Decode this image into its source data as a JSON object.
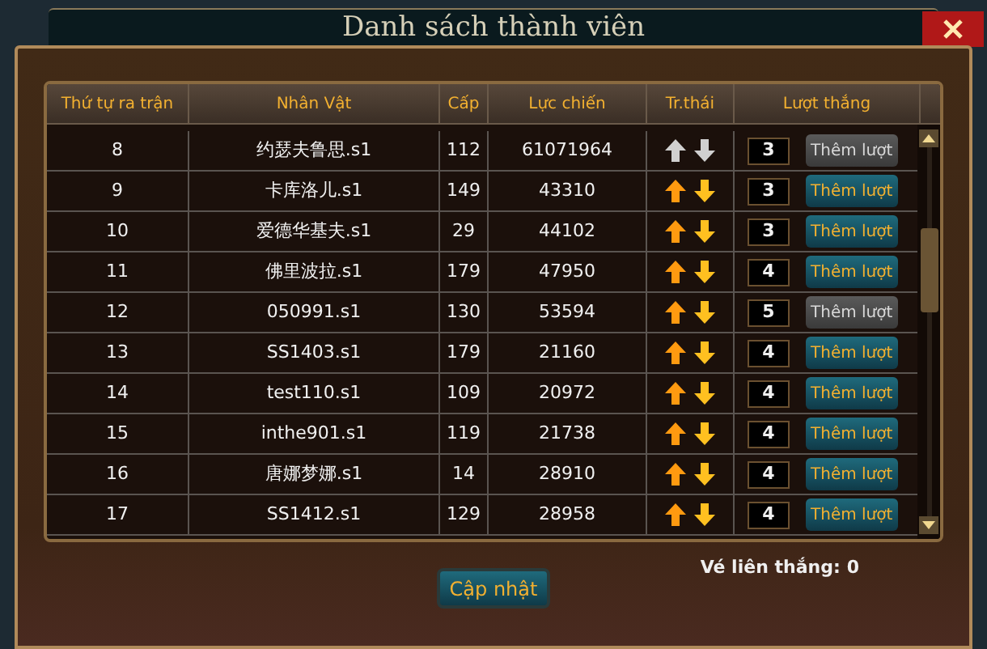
{
  "window": {
    "title": "Danh sách thành viên"
  },
  "table": {
    "columns": [
      "Thứ tự ra trận",
      "Nhân Vật",
      "Cấp",
      "Lực chiến",
      "Tr.thái",
      "Lượt thắng"
    ],
    "rows": [
      {
        "order": "8",
        "name": "约瑟夫鲁思.s1",
        "level": "112",
        "power": "61071964",
        "arrows_enabled": false,
        "wins": "3",
        "add_button": {
          "label": "Thêm lượt",
          "disabled": true
        }
      },
      {
        "order": "9",
        "name": "卡库洛儿.s1",
        "level": "149",
        "power": "43310",
        "arrows_enabled": true,
        "wins": "3",
        "add_button": {
          "label": "Thêm lượt",
          "disabled": false
        }
      },
      {
        "order": "10",
        "name": "爱德华基夫.s1",
        "level": "29",
        "power": "44102",
        "arrows_enabled": true,
        "wins": "3",
        "add_button": {
          "label": "Thêm lượt",
          "disabled": false
        }
      },
      {
        "order": "11",
        "name": "佛里波拉.s1",
        "level": "179",
        "power": "47950",
        "arrows_enabled": true,
        "wins": "4",
        "add_button": {
          "label": "Thêm lượt",
          "disabled": false
        }
      },
      {
        "order": "12",
        "name": "050991.s1",
        "level": "130",
        "power": "53594",
        "arrows_enabled": true,
        "wins": "5",
        "add_button": {
          "label": "Thêm lượt",
          "disabled": true
        }
      },
      {
        "order": "13",
        "name": "SS1403.s1",
        "level": "179",
        "power": "21160",
        "arrows_enabled": true,
        "wins": "4",
        "add_button": {
          "label": "Thêm lượt",
          "disabled": false
        }
      },
      {
        "order": "14",
        "name": "test110.s1",
        "level": "109",
        "power": "20972",
        "arrows_enabled": true,
        "wins": "4",
        "add_button": {
          "label": "Thêm lượt",
          "disabled": false
        }
      },
      {
        "order": "15",
        "name": "inthe901.s1",
        "level": "119",
        "power": "21738",
        "arrows_enabled": true,
        "wins": "4",
        "add_button": {
          "label": "Thêm lượt",
          "disabled": false
        }
      },
      {
        "order": "16",
        "name": "唐娜梦娜.s1",
        "level": "14",
        "power": "28910",
        "arrows_enabled": true,
        "wins": "4",
        "add_button": {
          "label": "Thêm lượt",
          "disabled": false
        }
      },
      {
        "order": "17",
        "name": "SS1412.s1",
        "level": "129",
        "power": "28958",
        "arrows_enabled": true,
        "wins": "4",
        "add_button": {
          "label": "Thêm lượt",
          "disabled": false
        }
      }
    ]
  },
  "update_button": {
    "label": "Cập nhật"
  },
  "streak": {
    "label": "Vé liên thắng:",
    "value": "0"
  }
}
